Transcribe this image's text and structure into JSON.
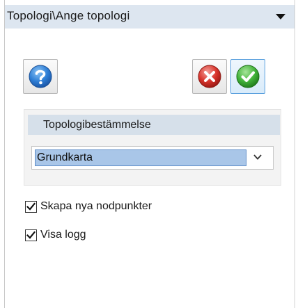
{
  "panel": {
    "title": "Topologi\\Ange topologi",
    "collapse_icon": "dropdown-triangle-icon"
  },
  "toolbar": {
    "help_icon": "help-question-icon",
    "cancel_icon": "cancel-x-icon",
    "ok_icon": "ok-check-icon",
    "colors": {
      "help": "#2f7fd6",
      "cancel": "#d8342c",
      "ok": "#43b33b"
    }
  },
  "group": {
    "header": "Topologibestämmelse",
    "select": {
      "value": "Grundkarta",
      "arrow_icon": "chevron-down-icon"
    }
  },
  "options": [
    {
      "label": "Skapa nya nodpunkter",
      "checked": true
    },
    {
      "label": "Visa logg",
      "checked": true
    }
  ]
}
